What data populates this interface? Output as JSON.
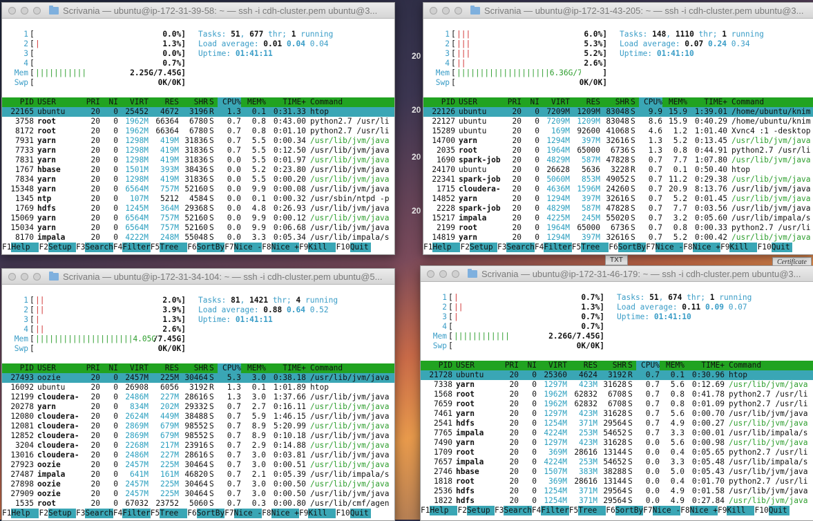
{
  "desktop": {
    "side_labels": [
      "20",
      "20",
      "20",
      "20"
    ],
    "file_label": "TXT",
    "cert_label": "Certificate"
  },
  "columns": [
    "PID",
    "USER",
    "PRI",
    "NI",
    "VIRT",
    "RES",
    "SHR",
    "S",
    "CPU%",
    "MEM%",
    "TIME+",
    "Command"
  ],
  "fkeys": [
    {
      "k": "F1",
      "v": "Help"
    },
    {
      "k": "F2",
      "v": "Setup"
    },
    {
      "k": "F3",
      "v": "Search"
    },
    {
      "k": "F4",
      "v": "Filter"
    },
    {
      "k": "F5",
      "v": "Tree"
    },
    {
      "k": "F6",
      "v": "SortBy"
    },
    {
      "k": "F7",
      "v": "Nice -"
    },
    {
      "k": "F8",
      "v": "Nice +"
    },
    {
      "k": "F9",
      "v": "Kill"
    },
    {
      "k": "F10",
      "v": "Quit"
    }
  ],
  "windows": [
    {
      "title": "Scrivania — ubuntu@ip-172-31-39-58: ~ — ssh -i cdh-cluster.pem ubuntu@3...",
      "cpus": [
        {
          "n": "1",
          "bar": "",
          "val": "0.0%]"
        },
        {
          "n": "2",
          "bar": "|",
          "val": "1.3%]"
        },
        {
          "n": "3",
          "bar": "",
          "val": "0.0%]"
        },
        {
          "n": "4",
          "bar": "",
          "val": "0.7%]"
        }
      ],
      "mem": {
        "bar": "|||||||||||",
        "val": "2.25G/7.45G]"
      },
      "swp": {
        "val": "0K/0K]"
      },
      "tasks": {
        "count": "51",
        "thr": "677",
        "running": "1"
      },
      "load": [
        "0.01",
        "0.04",
        "0.04"
      ],
      "uptime": "01:41:11",
      "selected": 0,
      "rows": [
        [
          "22165",
          "ubuntu",
          "20",
          "0",
          "25452",
          "4672",
          "3196",
          "R",
          "1.3",
          "0.1",
          "0:31.33",
          "htop"
        ],
        [
          "3758",
          "root",
          "20",
          "0",
          "1962M",
          "66364",
          "6780",
          "S",
          "0.7",
          "0.8",
          "0:43.00",
          "python2.7 /usr/li"
        ],
        [
          "8172",
          "root",
          "20",
          "0",
          "1962M",
          "66364",
          "6780",
          "S",
          "0.7",
          "0.8",
          "0:01.10",
          "python2.7 /usr/li"
        ],
        [
          "7931",
          "yarn",
          "20",
          "0",
          "1298M",
          "419M",
          "31836",
          "S",
          "0.7",
          "5.5",
          "0:00.34",
          "/usr/lib/jvm/java"
        ],
        [
          "7733",
          "yarn",
          "20",
          "0",
          "1298M",
          "419M",
          "31836",
          "S",
          "0.7",
          "5.5",
          "0:12.50",
          "/usr/lib/jvm/java"
        ],
        [
          "7831",
          "yarn",
          "20",
          "0",
          "1298M",
          "419M",
          "31836",
          "S",
          "0.0",
          "5.5",
          "0:01.97",
          "/usr/lib/jvm/java"
        ],
        [
          "1767",
          "hbase",
          "20",
          "0",
          "1501M",
          "393M",
          "38436",
          "S",
          "0.0",
          "5.2",
          "0:23.80",
          "/usr/lib/jvm/java"
        ],
        [
          "7834",
          "yarn",
          "20",
          "0",
          "1298M",
          "419M",
          "31836",
          "S",
          "0.0",
          "5.5",
          "0:00.20",
          "/usr/lib/jvm/java"
        ],
        [
          "15348",
          "yarn",
          "20",
          "0",
          "6564M",
          "757M",
          "52160",
          "S",
          "0.0",
          "9.9",
          "0:00.08",
          "/usr/lib/jvm/java"
        ],
        [
          "1345",
          "ntp",
          "20",
          "0",
          "107M",
          "5212",
          "4584",
          "S",
          "0.0",
          "0.1",
          "0:00.32",
          "/usr/sbin/ntpd -p"
        ],
        [
          "1769",
          "hdfs",
          "20",
          "0",
          "1245M",
          "364M",
          "29368",
          "S",
          "0.0",
          "4.8",
          "0:26.93",
          "/usr/lib/jvm/java"
        ],
        [
          "15069",
          "yarn",
          "20",
          "0",
          "6564M",
          "757M",
          "52160",
          "S",
          "0.0",
          "9.9",
          "0:00.12",
          "/usr/lib/jvm/java"
        ],
        [
          "15034",
          "yarn",
          "20",
          "0",
          "6564M",
          "757M",
          "52160",
          "S",
          "0.0",
          "9.9",
          "0:06.68",
          "/usr/lib/jvm/java"
        ],
        [
          "8170",
          "impala",
          "20",
          "0",
          "4222M",
          "248M",
          "55048",
          "S",
          "0.0",
          "3.3",
          "0:05.34",
          "/usr/lib/impala/s"
        ]
      ]
    },
    {
      "title": "Scrivania — ubuntu@ip-172-31-43-205: ~ — ssh -i cdh-cluster.pem ubuntu@3...",
      "cpus": [
        {
          "n": "1",
          "bar": "|||",
          "val": "6.0%]"
        },
        {
          "n": "2",
          "bar": "|||",
          "val": "5.3%]"
        },
        {
          "n": "3",
          "bar": "|||",
          "val": "5.2%]"
        },
        {
          "n": "4",
          "bar": "||",
          "val": "2.6%]"
        }
      ],
      "mem": {
        "bar": "||||||||||||||||||||6.36G/7.45G",
        "val": "]"
      },
      "swp": {
        "val": "0K/0K]"
      },
      "tasks": {
        "count": "148",
        "thr": "1110",
        "running": "1"
      },
      "load": [
        "0.07",
        "0.24",
        "0.34"
      ],
      "uptime": "01:41:10",
      "selected": 0,
      "rows": [
        [
          "22126",
          "ubuntu",
          "20",
          "0",
          "7209M",
          "1209M",
          "83048",
          "S",
          "9.9",
          "15.9",
          "1:39.01",
          "/home/ubuntu/knim"
        ],
        [
          "22127",
          "ubuntu",
          "20",
          "0",
          "7209M",
          "1209M",
          "83048",
          "S",
          "8.6",
          "15.9",
          "0:40.29",
          "/home/ubuntu/knim"
        ],
        [
          "15289",
          "ubuntu",
          "20",
          "0",
          "169M",
          "92600",
          "41068",
          "S",
          "4.6",
          "1.2",
          "1:01.40",
          "Xvnc4 :1 -desktop"
        ],
        [
          "14700",
          "yarn",
          "20",
          "0",
          "1294M",
          "397M",
          "32616",
          "S",
          "1.3",
          "5.2",
          "0:13.45",
          "/usr/lib/jvm/java"
        ],
        [
          "2035",
          "root",
          "20",
          "0",
          "1964M",
          "65000",
          "6736",
          "S",
          "1.3",
          "0.8",
          "0:44.91",
          "python2.7 /usr/li"
        ],
        [
          "1690",
          "spark-job",
          "20",
          "0",
          "4829M",
          "587M",
          "47828",
          "S",
          "0.7",
          "7.7",
          "1:07.80",
          "/usr/lib/jvm/java"
        ],
        [
          "24170",
          "ubuntu",
          "20",
          "0",
          "26628",
          "5636",
          "3228",
          "R",
          "0.7",
          "0.1",
          "0:50.40",
          "htop"
        ],
        [
          "22341",
          "spark-job",
          "20",
          "0",
          "5060M",
          "853M",
          "49052",
          "S",
          "0.7",
          "11.2",
          "0:29.38",
          "/usr/lib/jvm/java"
        ],
        [
          "1715",
          "cloudera-",
          "20",
          "0",
          "4636M",
          "1596M",
          "24260",
          "S",
          "0.7",
          "20.9",
          "8:13.76",
          "/usr/lib/jvm/java"
        ],
        [
          "14852",
          "yarn",
          "20",
          "0",
          "1294M",
          "397M",
          "32616",
          "S",
          "0.7",
          "5.2",
          "0:01.45",
          "/usr/lib/jvm/java"
        ],
        [
          "2228",
          "spark-job",
          "20",
          "0",
          "4829M",
          "587M",
          "47828",
          "S",
          "0.7",
          "7.7",
          "0:03.56",
          "/usr/lib/jvm/java"
        ],
        [
          "15217",
          "impala",
          "20",
          "0",
          "4225M",
          "245M",
          "55020",
          "S",
          "0.7",
          "3.2",
          "0:05.60",
          "/usr/lib/impala/s"
        ],
        [
          "2199",
          "root",
          "20",
          "0",
          "1964M",
          "65000",
          "6736",
          "S",
          "0.7",
          "0.8",
          "0:00.33",
          "python2.7 /usr/li"
        ],
        [
          "14819",
          "yarn",
          "20",
          "0",
          "1294M",
          "397M",
          "32616",
          "S",
          "0.7",
          "5.2",
          "0:00.42",
          "/usr/lib/jvm/java"
        ]
      ]
    },
    {
      "title": "Scrivania — ubuntu@ip-172-31-34-104: ~ — ssh -i cdh-cluster.pem ubuntu@5...",
      "cpus": [
        {
          "n": "1",
          "bar": "||",
          "val": "2.0%]"
        },
        {
          "n": "2",
          "bar": "||",
          "val": "3.9%]"
        },
        {
          "n": "3",
          "bar": "|",
          "val": "1.3%]"
        },
        {
          "n": "4",
          "bar": "||",
          "val": "2.6%]"
        }
      ],
      "mem": {
        "bar": "|||||||||||||||||||||4.05G",
        "val": "/7.45G]"
      },
      "swp": {
        "val": "0K/0K]"
      },
      "tasks": {
        "count": "81",
        "thr": "1421",
        "running": "4"
      },
      "load": [
        "0.88",
        "0.64",
        "0.52"
      ],
      "uptime": "01:41:11",
      "selected": 0,
      "rows": [
        [
          "27493",
          "oozie",
          "20",
          "0",
          "2457M",
          "225M",
          "30464",
          "S",
          "5.3",
          "3.0",
          "0:38.18",
          "/usr/lib/jvm/java"
        ],
        [
          "16092",
          "ubuntu",
          "20",
          "0",
          "26908",
          "6056",
          "3192",
          "R",
          "1.3",
          "0.1",
          "1:01.89",
          "htop"
        ],
        [
          "12199",
          "cloudera-",
          "20",
          "0",
          "2486M",
          "227M",
          "28616",
          "S",
          "1.3",
          "3.0",
          "1:37.66",
          "/usr/lib/jvm/java"
        ],
        [
          "20278",
          "yarn",
          "20",
          "0",
          "834M",
          "202M",
          "29332",
          "S",
          "0.7",
          "2.7",
          "0:16.11",
          "/usr/lib/jvm/java"
        ],
        [
          "12080",
          "cloudera-",
          "20",
          "0",
          "2624M",
          "449M",
          "38488",
          "S",
          "0.7",
          "5.9",
          "1:46.15",
          "/usr/lib/jvm/java"
        ],
        [
          "12081",
          "cloudera-",
          "20",
          "0",
          "2869M",
          "679M",
          "98552",
          "S",
          "0.7",
          "8.9",
          "5:20.99",
          "/usr/lib/jvm/java"
        ],
        [
          "12852",
          "cloudera-",
          "20",
          "0",
          "2869M",
          "679M",
          "98552",
          "S",
          "0.7",
          "8.9",
          "0:10.18",
          "/usr/lib/jvm/java"
        ],
        [
          "3204",
          "cloudera-",
          "20",
          "0",
          "2268M",
          "217M",
          "23916",
          "S",
          "0.7",
          "2.9",
          "0:14.88",
          "/usr/lib/jvm/java"
        ],
        [
          "13016",
          "cloudera-",
          "20",
          "0",
          "2486M",
          "227M",
          "28616",
          "S",
          "0.7",
          "3.0",
          "0:03.81",
          "/usr/lib/jvm/java"
        ],
        [
          "27923",
          "oozie",
          "20",
          "0",
          "2457M",
          "225M",
          "30464",
          "S",
          "0.7",
          "3.0",
          "0:00.51",
          "/usr/lib/jvm/java"
        ],
        [
          "27487",
          "impala",
          "20",
          "0",
          "641M",
          "161M",
          "46820",
          "S",
          "0.7",
          "2.1",
          "0:05.39",
          "/usr/lib/impala/s"
        ],
        [
          "27898",
          "oozie",
          "20",
          "0",
          "2457M",
          "225M",
          "30464",
          "S",
          "0.7",
          "3.0",
          "0:00.50",
          "/usr/lib/jvm/java"
        ],
        [
          "27909",
          "oozie",
          "20",
          "0",
          "2457M",
          "225M",
          "30464",
          "S",
          "0.7",
          "3.0",
          "0:00.50",
          "/usr/lib/jvm/java"
        ],
        [
          "1535",
          "root",
          "20",
          "0",
          "67032",
          "23752",
          "5060",
          "S",
          "0.7",
          "0.3",
          "0:00.80",
          "/usr/lib/cmf/agen"
        ]
      ]
    },
    {
      "title": "Scrivania — ubuntu@ip-172-31-46-179: ~ — ssh -i cdh-cluster.pem ubuntu@3...",
      "cpus": [
        {
          "n": "1",
          "bar": "|",
          "val": "0.7%]"
        },
        {
          "n": "2",
          "bar": "||",
          "val": "1.3%]"
        },
        {
          "n": "3",
          "bar": "|",
          "val": "0.7%]"
        },
        {
          "n": "4",
          "bar": "",
          "val": "0.7%]"
        }
      ],
      "mem": {
        "bar": "||||||||||||",
        "val": "2.26G/7.45G]"
      },
      "swp": {
        "val": "0K/0K]"
      },
      "tasks": {
        "count": "51",
        "thr": "674",
        "running": "1"
      },
      "load": [
        "0.11",
        "0.09",
        "0.07"
      ],
      "uptime": "01:41:10",
      "selected": 0,
      "rows": [
        [
          "21728",
          "ubuntu",
          "20",
          "0",
          "25360",
          "4624",
          "3192",
          "R",
          "0.7",
          "0.1",
          "0:30.96",
          "htop"
        ],
        [
          "7338",
          "yarn",
          "20",
          "0",
          "1297M",
          "423M",
          "31628",
          "S",
          "0.7",
          "5.6",
          "0:12.69",
          "/usr/lib/jvm/java"
        ],
        [
          "1568",
          "root",
          "20",
          "0",
          "1962M",
          "62832",
          "6708",
          "S",
          "0.7",
          "0.8",
          "0:41.78",
          "python2.7 /usr/li"
        ],
        [
          "7659",
          "root",
          "20",
          "0",
          "1962M",
          "62832",
          "6708",
          "S",
          "0.7",
          "0.8",
          "0:01.09",
          "python2.7 /usr/li"
        ],
        [
          "7461",
          "yarn",
          "20",
          "0",
          "1297M",
          "423M",
          "31628",
          "S",
          "0.7",
          "5.6",
          "0:00.70",
          "/usr/lib/jvm/java"
        ],
        [
          "2541",
          "hdfs",
          "20",
          "0",
          "1254M",
          "371M",
          "29564",
          "S",
          "0.7",
          "4.9",
          "0:00.27",
          "/usr/lib/jvm/java"
        ],
        [
          "7765",
          "impala",
          "20",
          "0",
          "4224M",
          "253M",
          "54652",
          "S",
          "0.7",
          "3.3",
          "0:00.01",
          "/usr/lib/impala/s"
        ],
        [
          "7490",
          "yarn",
          "20",
          "0",
          "1297M",
          "423M",
          "31628",
          "S",
          "0.0",
          "5.6",
          "0:00.98",
          "/usr/lib/jvm/java"
        ],
        [
          "1709",
          "root",
          "20",
          "0",
          "369M",
          "28616",
          "13144",
          "S",
          "0.0",
          "0.4",
          "0:05.65",
          "python2.7 /usr/li"
        ],
        [
          "7657",
          "impala",
          "20",
          "0",
          "4224M",
          "253M",
          "54652",
          "S",
          "0.0",
          "3.3",
          "0:05.48",
          "/usr/lib/impala/s"
        ],
        [
          "2746",
          "hbase",
          "20",
          "0",
          "1507M",
          "383M",
          "38288",
          "S",
          "0.0",
          "5.0",
          "0:05.43",
          "/usr/lib/jvm/java"
        ],
        [
          "1818",
          "root",
          "20",
          "0",
          "369M",
          "28616",
          "13144",
          "S",
          "0.0",
          "0.4",
          "0:01.70",
          "python2.7 /usr/li"
        ],
        [
          "2536",
          "hdfs",
          "20",
          "0",
          "1254M",
          "371M",
          "29564",
          "S",
          "0.0",
          "4.9",
          "0:01.58",
          "/usr/lib/jvm/java"
        ],
        [
          "1822",
          "hdfs",
          "20",
          "0",
          "1254M",
          "371M",
          "29564",
          "S",
          "0.0",
          "4.9",
          "0:27.84",
          "/usr/lib/jvm/java"
        ]
      ]
    }
  ]
}
